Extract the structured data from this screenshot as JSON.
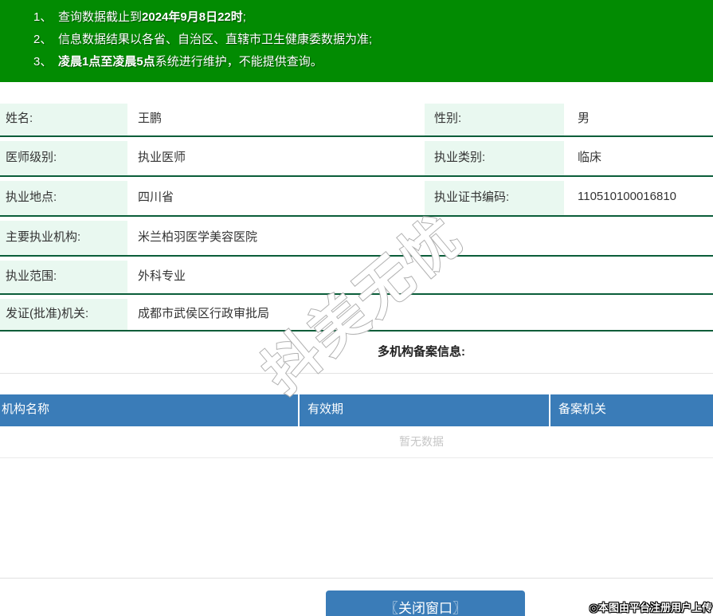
{
  "banner": {
    "bg_color": "#028b02",
    "items": [
      {
        "num": "1、",
        "pre": "查询数据截止到",
        "bold": "2024年9月8日22时",
        "post": ";"
      },
      {
        "num": "2、",
        "pre": "信息数据结果以各省、自治区、直辖市卫生健康委数据为准;",
        "bold": "",
        "post": ""
      },
      {
        "num": "3、",
        "pre": "",
        "bold": "凌晨1点至凌晨5点",
        "post": "系统进行维护，不能提供查询。"
      }
    ]
  },
  "info": {
    "label_bg": "#e9f8f0",
    "border_color": "#0a5d39",
    "rows": [
      {
        "label1": "姓名:",
        "value1": "王鹏",
        "label2": "性别:",
        "value2": "男"
      },
      {
        "label1": "医师级别:",
        "value1": "执业医师",
        "label2": "执业类别:",
        "value2": "临床"
      },
      {
        "label1": "执业地点:",
        "value1": "四川省",
        "label2": "执业证书编码:",
        "value2": "110510100016810"
      },
      {
        "label1": "主要执业机构:",
        "value1": "米兰柏羽医学美容医院"
      },
      {
        "label1": "执业范围:",
        "value1": "外科专业"
      },
      {
        "label1": "发证(批准)机关:",
        "value1": "成都市武侯区行政审批局"
      }
    ]
  },
  "filing": {
    "title": "多机构备案信息:",
    "header_bg": "#3a7cb8",
    "columns": [
      "机构名称",
      "有效期",
      "备案机关"
    ],
    "empty_text": "暂无数据"
  },
  "watermark": {
    "text": "抖美无忧"
  },
  "footer": {
    "close_button": "〖关闭窗口〗",
    "button_color": "#3a7cb8",
    "credit": "◎本图由平台注册用户上传"
  }
}
